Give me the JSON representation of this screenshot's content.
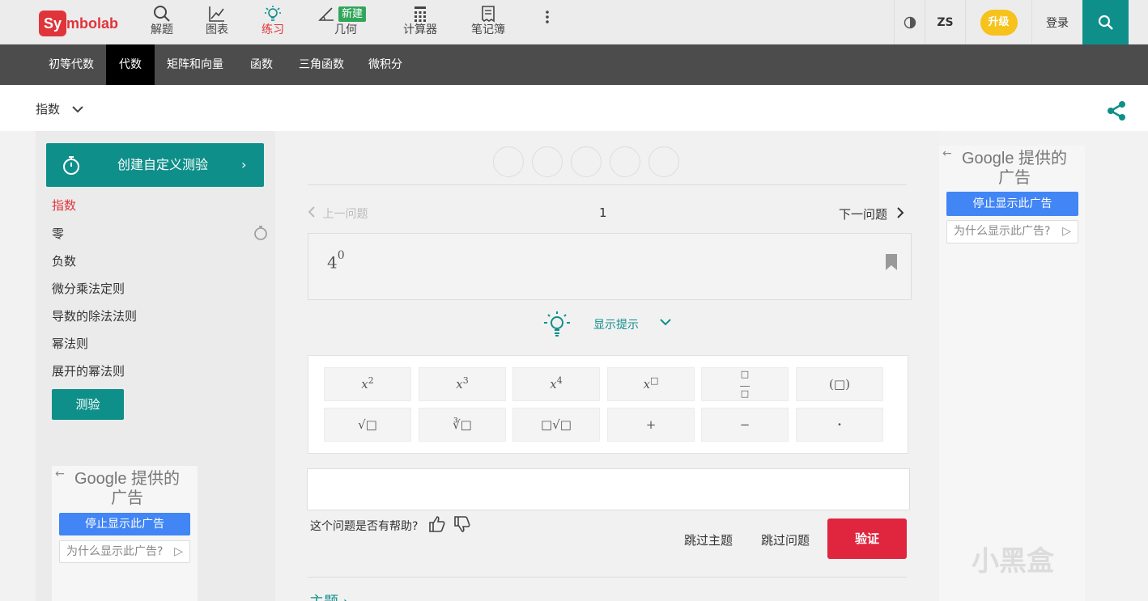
{
  "brand": {
    "logo_short": "Sy",
    "logo_rest": "mbolab"
  },
  "topnav": [
    {
      "label": "解题",
      "icon": "search-icon"
    },
    {
      "label": "图表",
      "icon": "graph-icon"
    },
    {
      "label": "练习",
      "icon": "lightbulb-icon"
    },
    {
      "label": "几何",
      "icon": "angle-icon",
      "badge": "新建"
    },
    {
      "label": "计算器",
      "icon": "calculator-icon"
    },
    {
      "label": "笔记簿",
      "icon": "notebook-icon"
    }
  ],
  "topright": {
    "user": "ZS",
    "upgrade": "升级",
    "login": "登录"
  },
  "categories": [
    "初等代数",
    "代数",
    "矩阵和向量",
    "函数",
    "三角函数",
    "微积分"
  ],
  "active_category": "代数",
  "topic": "指数",
  "sidebar": {
    "create_quiz": "创建自定义测验",
    "items": [
      "指数",
      "零",
      "负数",
      "微分乘法定则",
      "导数的除法法则",
      "幂法则",
      "展开的幂法则"
    ],
    "test_button": "测验"
  },
  "ads": {
    "provider_line1": "Google 提供的",
    "provider_line2": "广告",
    "stop": "停止显示此广告",
    "why": "为什么显示此广告?"
  },
  "question": {
    "prev": "上一问题",
    "number": "1",
    "next": "下一问题",
    "base": "4",
    "exponent": "0",
    "hint": "显示提示"
  },
  "keypad": {
    "row1": [
      {
        "base": "x",
        "sup": "2"
      },
      {
        "base": "x",
        "sup": "3"
      },
      {
        "base": "x",
        "sup": "4"
      },
      {
        "base": "x",
        "sup": "□"
      },
      {
        "base": "□/□",
        "sup": ""
      },
      {
        "base": "(□)",
        "sup": ""
      }
    ],
    "row2": [
      "√□",
      "∛□",
      "□√□",
      "+",
      "−",
      "·"
    ]
  },
  "feedback": {
    "question": "这个问题是否有帮助?",
    "skip_topic": "跳过主题",
    "skip_question": "跳过问题",
    "verify": "验证"
  },
  "topics_link": "主题",
  "watermark": "小黑盒"
}
